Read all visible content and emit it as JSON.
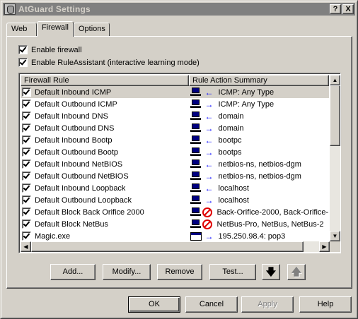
{
  "window": {
    "title": "AtGuard Settings",
    "help_button": "?",
    "close_button": "X"
  },
  "tabs": [
    {
      "label": "Web",
      "active": false
    },
    {
      "label": "Firewall",
      "active": true
    },
    {
      "label": "Options",
      "active": false
    }
  ],
  "settings": {
    "enable_firewall": {
      "label": "Enable firewall",
      "checked": true
    },
    "enable_ruleassistant": {
      "label": "Enable RuleAssistant (interactive learning mode)",
      "checked": true
    }
  },
  "list": {
    "col_rule": "Firewall Rule",
    "col_action": "Rule Action Summary",
    "rows": [
      {
        "name": "Default Inbound ICMP",
        "icon": "pc-icon",
        "direction": "inbound-arrow-icon",
        "blocked": false,
        "summary": "ICMP: Any Type",
        "selected": true
      },
      {
        "name": "Default Outbound ICMP",
        "icon": "pc-icon",
        "direction": "outbound-arrow-icon",
        "blocked": false,
        "summary": "ICMP: Any Type",
        "selected": false
      },
      {
        "name": "Default Inbound DNS",
        "icon": "pc-icon",
        "direction": "inbound-arrow-icon",
        "blocked": false,
        "summary": "domain",
        "selected": false
      },
      {
        "name": "Default Outbound DNS",
        "icon": "pc-icon",
        "direction": "outbound-arrow-icon",
        "blocked": false,
        "summary": "domain",
        "selected": false
      },
      {
        "name": "Default Inbound Bootp",
        "icon": "pc-icon",
        "direction": "inbound-arrow-icon",
        "blocked": false,
        "summary": "bootpc",
        "selected": false
      },
      {
        "name": "Default Outbound Bootp",
        "icon": "pc-icon",
        "direction": "outbound-arrow-icon",
        "blocked": false,
        "summary": "bootps",
        "selected": false
      },
      {
        "name": "Default Inbound NetBIOS",
        "icon": "pc-icon",
        "direction": "inbound-arrow-icon",
        "blocked": false,
        "summary": "netbios-ns, netbios-dgm",
        "selected": false
      },
      {
        "name": "Default Outbound NetBIOS",
        "icon": "pc-icon",
        "direction": "outbound-arrow-icon",
        "blocked": false,
        "summary": "netbios-ns, netbios-dgm",
        "selected": false
      },
      {
        "name": "Default Inbound Loopback",
        "icon": "pc-icon",
        "direction": "inbound-arrow-icon",
        "blocked": false,
        "summary": "localhost",
        "selected": false
      },
      {
        "name": "Default Outbound Loopback",
        "icon": "pc-icon",
        "direction": "outbound-arrow-icon",
        "blocked": false,
        "summary": "localhost",
        "selected": false
      },
      {
        "name": "Default Block Back Orifice 2000",
        "icon": "pc-icon",
        "direction": "block-icon",
        "blocked": true,
        "summary": "Back-Orifice-2000, Back-Orifice-...",
        "selected": false
      },
      {
        "name": "Default Block NetBus",
        "icon": "pc-icon",
        "direction": "block-icon",
        "blocked": true,
        "summary": "NetBus-Pro, NetBus, NetBus-2",
        "selected": false
      },
      {
        "name": "Magic.exe",
        "icon": "application-icon",
        "direction": "outbound-arrow-icon",
        "blocked": false,
        "summary": "195.250.98.4: pop3",
        "selected": false
      }
    ]
  },
  "actions": {
    "add": "Add...",
    "modify": "Modify...",
    "remove": "Remove",
    "test": "Test...",
    "move_down": "🡇",
    "move_up": "🡅"
  },
  "dialog_buttons": {
    "ok": "OK",
    "cancel": "Cancel",
    "apply": "Apply",
    "help": "Help"
  },
  "colors": {
    "titlebar_inactive": "#808080",
    "arrow": "#0000ff",
    "block": "#e00000",
    "face": "#d4d0c8"
  }
}
